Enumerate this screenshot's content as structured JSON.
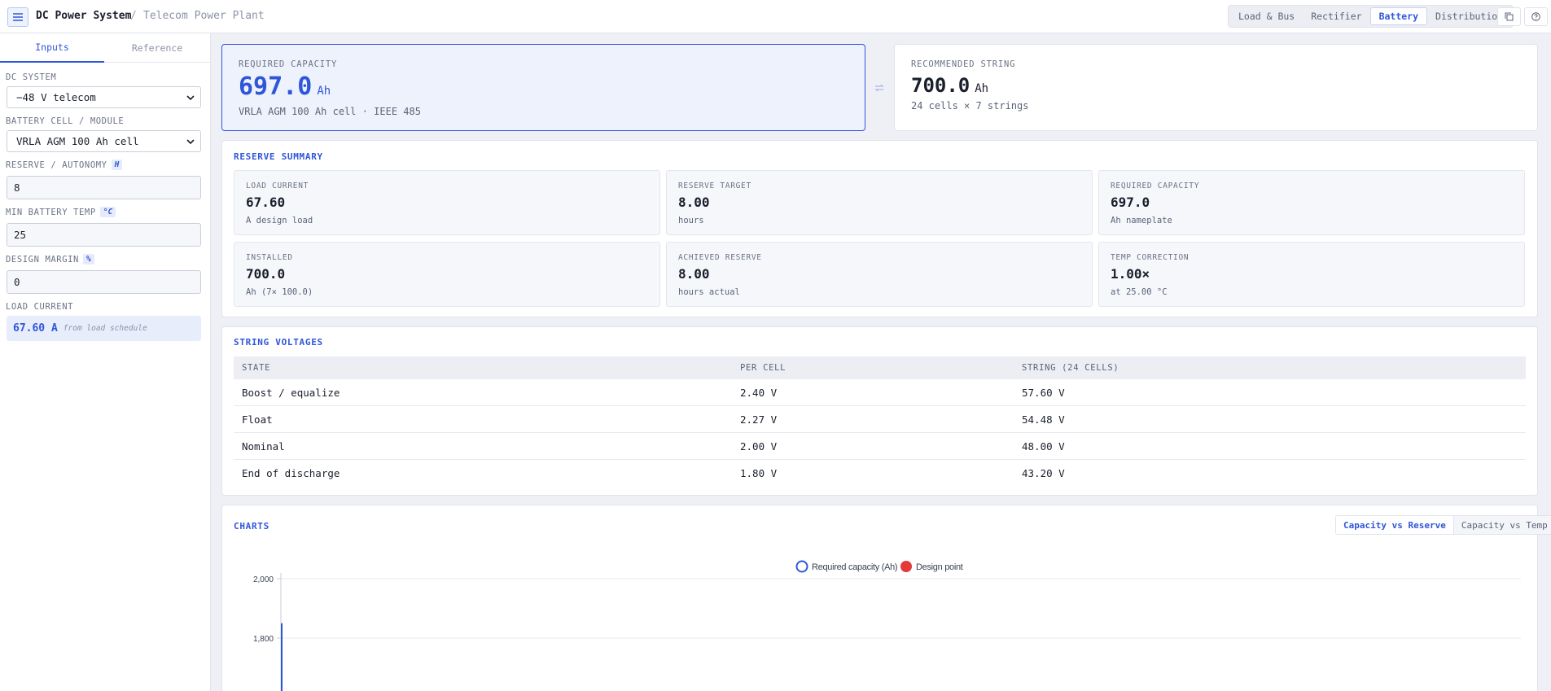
{
  "header": {
    "title": "DC Power System",
    "separator": "/",
    "subtitle": "Telecom Power Plant",
    "tabs": [
      {
        "label": "Load & Bus",
        "active": false
      },
      {
        "label": "Rectifier",
        "active": false
      },
      {
        "label": "Battery",
        "active": true
      },
      {
        "label": "Distribution",
        "active": false
      }
    ]
  },
  "sidebar": {
    "tabs": [
      {
        "label": "Inputs",
        "active": true
      },
      {
        "label": "Reference",
        "active": false
      }
    ],
    "dc_system": {
      "label": "DC SYSTEM",
      "value": "−48 V telecom"
    },
    "battery_cell": {
      "label": "BATTERY CELL / MODULE",
      "value": "VRLA AGM 100 Ah cell"
    },
    "reserve": {
      "label": "RESERVE / AUTONOMY",
      "unit": "H",
      "value": "8"
    },
    "min_temp": {
      "label": "MIN BATTERY TEMP",
      "unit": "°C",
      "value": "25"
    },
    "margin": {
      "label": "DESIGN MARGIN",
      "unit": "%",
      "value": "0"
    },
    "load_current": {
      "label": "LOAD CURRENT",
      "value": "67.60 A",
      "note": "from load schedule"
    }
  },
  "required": {
    "label": "REQUIRED CAPACITY",
    "value": "697.0",
    "unit": "Ah",
    "note": "VRLA AGM 100 Ah cell · IEEE 485"
  },
  "recommended": {
    "label": "RECOMMENDED STRING",
    "value": "700.0",
    "unit": "Ah",
    "note": "24 cells × 7 strings"
  },
  "reserve_summary": {
    "title": "RESERVE SUMMARY",
    "stats": [
      {
        "label": "LOAD CURRENT",
        "value": "67.60",
        "sub": "A design load"
      },
      {
        "label": "RESERVE TARGET",
        "value": "8.00",
        "sub": "hours"
      },
      {
        "label": "REQUIRED CAPACITY",
        "value": "697.0",
        "sub": "Ah nameplate"
      },
      {
        "label": "INSTALLED",
        "value": "700.0",
        "sub": "Ah (7× 100.0)"
      },
      {
        "label": "ACHIEVED RESERVE",
        "value": "8.00",
        "sub": "hours actual"
      },
      {
        "label": "TEMP CORRECTION",
        "value": "1.00×",
        "sub": "at 25.00 °C"
      }
    ]
  },
  "string_voltages": {
    "title": "STRING VOLTAGES",
    "columns": [
      "STATE",
      "PER CELL",
      "STRING (24 CELLS)"
    ],
    "rows": [
      [
        "Boost / equalize",
        "2.40 V",
        "57.60 V"
      ],
      [
        "Float",
        "2.27 V",
        "54.48 V"
      ],
      [
        "Nominal",
        "2.00 V",
        "48.00 V"
      ],
      [
        "End of discharge",
        "1.80 V",
        "43.20 V"
      ]
    ]
  },
  "charts": {
    "title": "CHARTS",
    "tabs": [
      {
        "label": "Capacity vs Reserve",
        "active": true
      },
      {
        "label": "Capacity vs Temp",
        "active": false
      }
    ]
  },
  "chart_data": {
    "type": "line",
    "series": [
      {
        "name": "Required capacity (Ah)",
        "color": "#2f56d9",
        "values": [
          1850
        ]
      },
      {
        "name": "Design point",
        "color": "#e5383b"
      }
    ],
    "y_ticks": [
      "2,000",
      "1,800"
    ],
    "y_visible_range": [
      1600,
      2000
    ],
    "grid": true,
    "legend": "top-center"
  },
  "colors": {
    "accent": "#2f56d9",
    "design_point": "#e5383b"
  },
  "icons": {
    "menu": "menu-icon",
    "copy": "copy-icon",
    "help": "help-icon",
    "swap": "swap-icon",
    "dropdown": "chevron-down-icon"
  }
}
